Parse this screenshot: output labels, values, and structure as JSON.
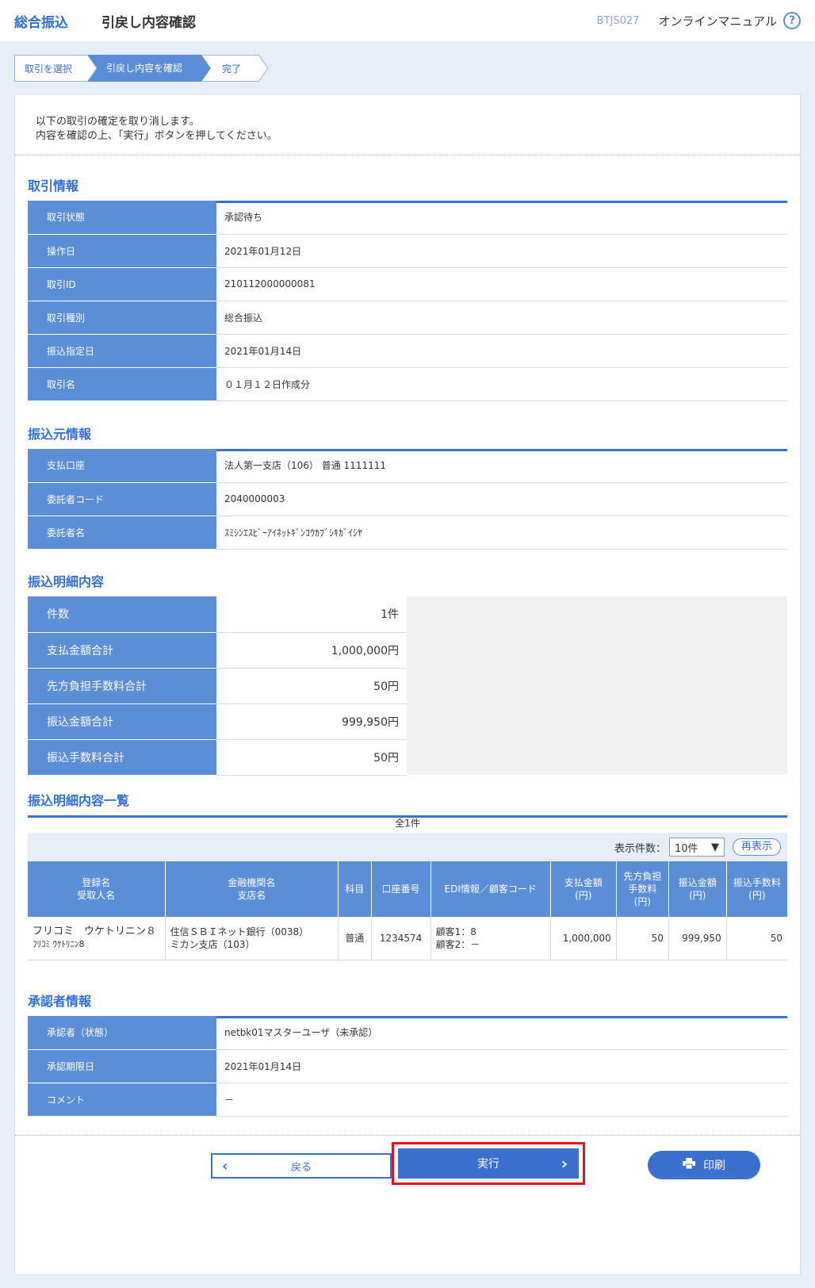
{
  "header": {
    "service": "総合振込",
    "title": "引戻し内容確認",
    "screen_id": "BTJS027",
    "manual": "オンラインマニュアル",
    "help": "?"
  },
  "steps": [
    "取引を選択",
    "引戻し内容を確認",
    "完了"
  ],
  "intro": {
    "line1": "以下の取引の確定を取り消します。",
    "line2": "内容を確認の上、「実行」ボタンを押してください。"
  },
  "transaction": {
    "title": "取引情報",
    "rows": [
      {
        "label": "取引状態",
        "value": "承認待ち"
      },
      {
        "label": "操作日",
        "value": "2021年01月12日"
      },
      {
        "label": "取引ID",
        "value": "210112000000081"
      },
      {
        "label": "取引種別",
        "value": "総合振込"
      },
      {
        "label": "振込指定日",
        "value": "2021年01月14日"
      },
      {
        "label": "取引名",
        "value": "０１月１２日作成分"
      }
    ]
  },
  "source": {
    "title": "振込元情報",
    "rows": [
      {
        "label": "支払口座",
        "value": "法人第一支店（106） 普通 1111111"
      },
      {
        "label": "委託者コード",
        "value": "2040000003"
      },
      {
        "label": "委託者名",
        "value": "ｽﾐｼﾝｴｽﾋﾞｰｱｲﾈｯﾄｷﾞﾝｺｳｶﾌﾞｼｷｶﾞｲｼﾔ"
      }
    ]
  },
  "summary": {
    "title": "振込明細内容",
    "rows": [
      {
        "label": "件数",
        "value": "1件"
      },
      {
        "label": "支払金額合計",
        "value": "1,000,000円"
      },
      {
        "label": "先方負担手数料合計",
        "value": "50円"
      },
      {
        "label": "振込金額合計",
        "value": "999,950円"
      },
      {
        "label": "振込手数料合計",
        "value": "50円"
      }
    ]
  },
  "list": {
    "title": "振込明細内容一覧",
    "total": "全1件",
    "display_count_label": "表示件数：",
    "display_count_value": "10件",
    "refresh": "再表示",
    "headers": {
      "name1": "登録名",
      "name2": "受取人名",
      "bank1": "金融機関名",
      "bank2": "支店名",
      "type": "科目",
      "account": "口座番号",
      "edi": "EDI情報／顧客コード",
      "pay1": "支払金額",
      "pay2": "(円)",
      "fee1": "先方負担",
      "fee2": "手数料",
      "fee3": "(円)",
      "amt1": "振込金額",
      "amt2": "(円)",
      "tfee1": "振込手数料",
      "tfee2": "(円)"
    },
    "row": {
      "name1": "フリコミ　ウケトリニン８",
      "name2": "ﾌﾘｺﾐ ｳｹﾄﾘﾆﾝ8",
      "bank1": "住信ＳＢＩネット銀行（0038）",
      "bank2": "ミカン支店（103）",
      "type": "普通",
      "account": "1234574",
      "edi1": "顧客1：8",
      "edi2": "顧客2：－",
      "pay": "1,000,000",
      "fee": "50",
      "amount": "999,950",
      "tfee": "50"
    }
  },
  "approver": {
    "title": "承認者情報",
    "rows": [
      {
        "label": "承認者（状態）",
        "value": "netbk01マスターユーザ（未承認）"
      },
      {
        "label": "承認期限日",
        "value": "2021年01月14日"
      },
      {
        "label": "コメント",
        "value": "－"
      }
    ]
  },
  "buttons": {
    "back": "戻る",
    "execute": "実行",
    "print": "印刷"
  },
  "colors": {
    "accent": "#3b6fd0",
    "header_cell": "#5b8ed6",
    "highlight": "#e0141e"
  }
}
